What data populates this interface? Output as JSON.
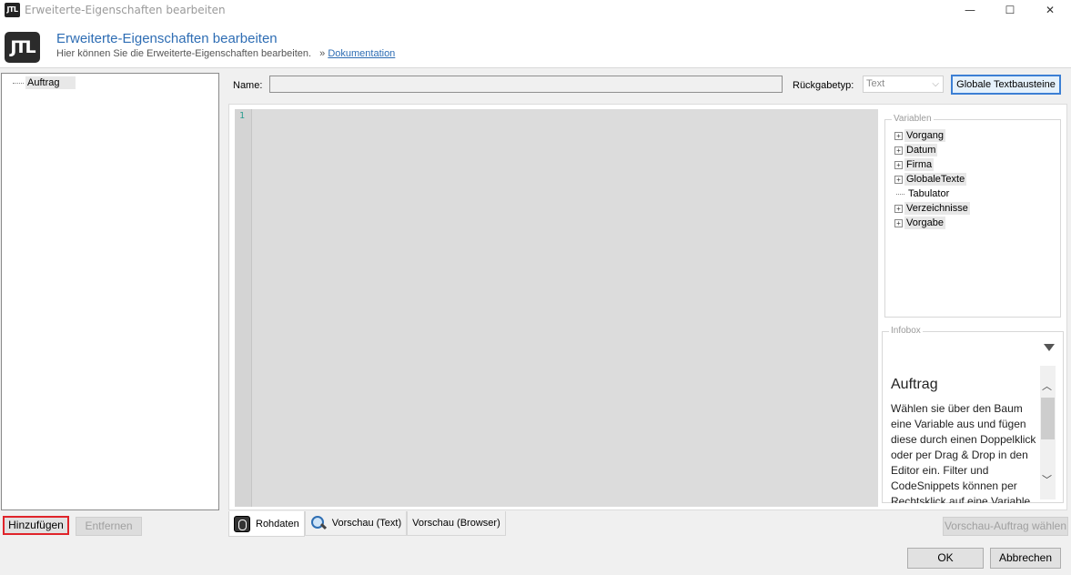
{
  "window": {
    "app_icon_text": "JTL",
    "title": "Erweiterte-Eigenschaften bearbeiten",
    "minimize": "—",
    "maximize": "☐",
    "close": "✕"
  },
  "header": {
    "logo_text": "JTL",
    "title": "Erweiterte-Eigenschaften bearbeiten",
    "subtitle": "Hier können Sie die Erweiterte-Eigenschaften bearbeiten.",
    "link_prefix": "»",
    "link_label": "Dokumentation"
  },
  "left_tree": {
    "items": [
      {
        "label": "Auftrag"
      }
    ]
  },
  "left_buttons": {
    "add": "Hinzufügen",
    "remove": "Entfernen"
  },
  "form": {
    "name_label": "Name:",
    "name_value": "",
    "return_type_label": "Rückgabetyp:",
    "return_type_value": "Text",
    "global_button": "Globale Textbausteine"
  },
  "editor": {
    "line_numbers": [
      "1"
    ]
  },
  "variables": {
    "legend": "Variablen",
    "items": [
      {
        "label": "Vorgang",
        "expandable": true
      },
      {
        "label": "Datum",
        "expandable": true
      },
      {
        "label": "Firma",
        "expandable": true
      },
      {
        "label": "GlobaleTexte",
        "expandable": true
      },
      {
        "label": "Tabulator",
        "expandable": false
      },
      {
        "label": "Verzeichnisse",
        "expandable": true
      },
      {
        "label": "Vorgabe",
        "expandable": true
      }
    ]
  },
  "infobox": {
    "legend": "Infobox",
    "title": "Auftrag",
    "text": "Wählen sie über den Baum eine Variable aus und fügen diese durch einen Doppelklick oder per Drag & Drop in den Editor ein. Filter und CodeSnippets können per Rechtsklick auf eine Variable eingefügt werden."
  },
  "tabs": [
    {
      "label": "Rohdaten",
      "icon": "raw-data-icon",
      "active": true
    },
    {
      "label": "Vorschau (Text)",
      "icon": "magnifier-icon",
      "active": false
    },
    {
      "label": "Vorschau (Browser)",
      "icon": "",
      "active": false
    }
  ],
  "preview_button": "Vorschau-Auftrag wählen",
  "footer": {
    "ok": "OK",
    "cancel": "Abbrechen"
  },
  "colors": {
    "accent_blue": "#2e6db4",
    "highlight_red": "#e0242a",
    "focus_blue": "#3c7fd4"
  }
}
